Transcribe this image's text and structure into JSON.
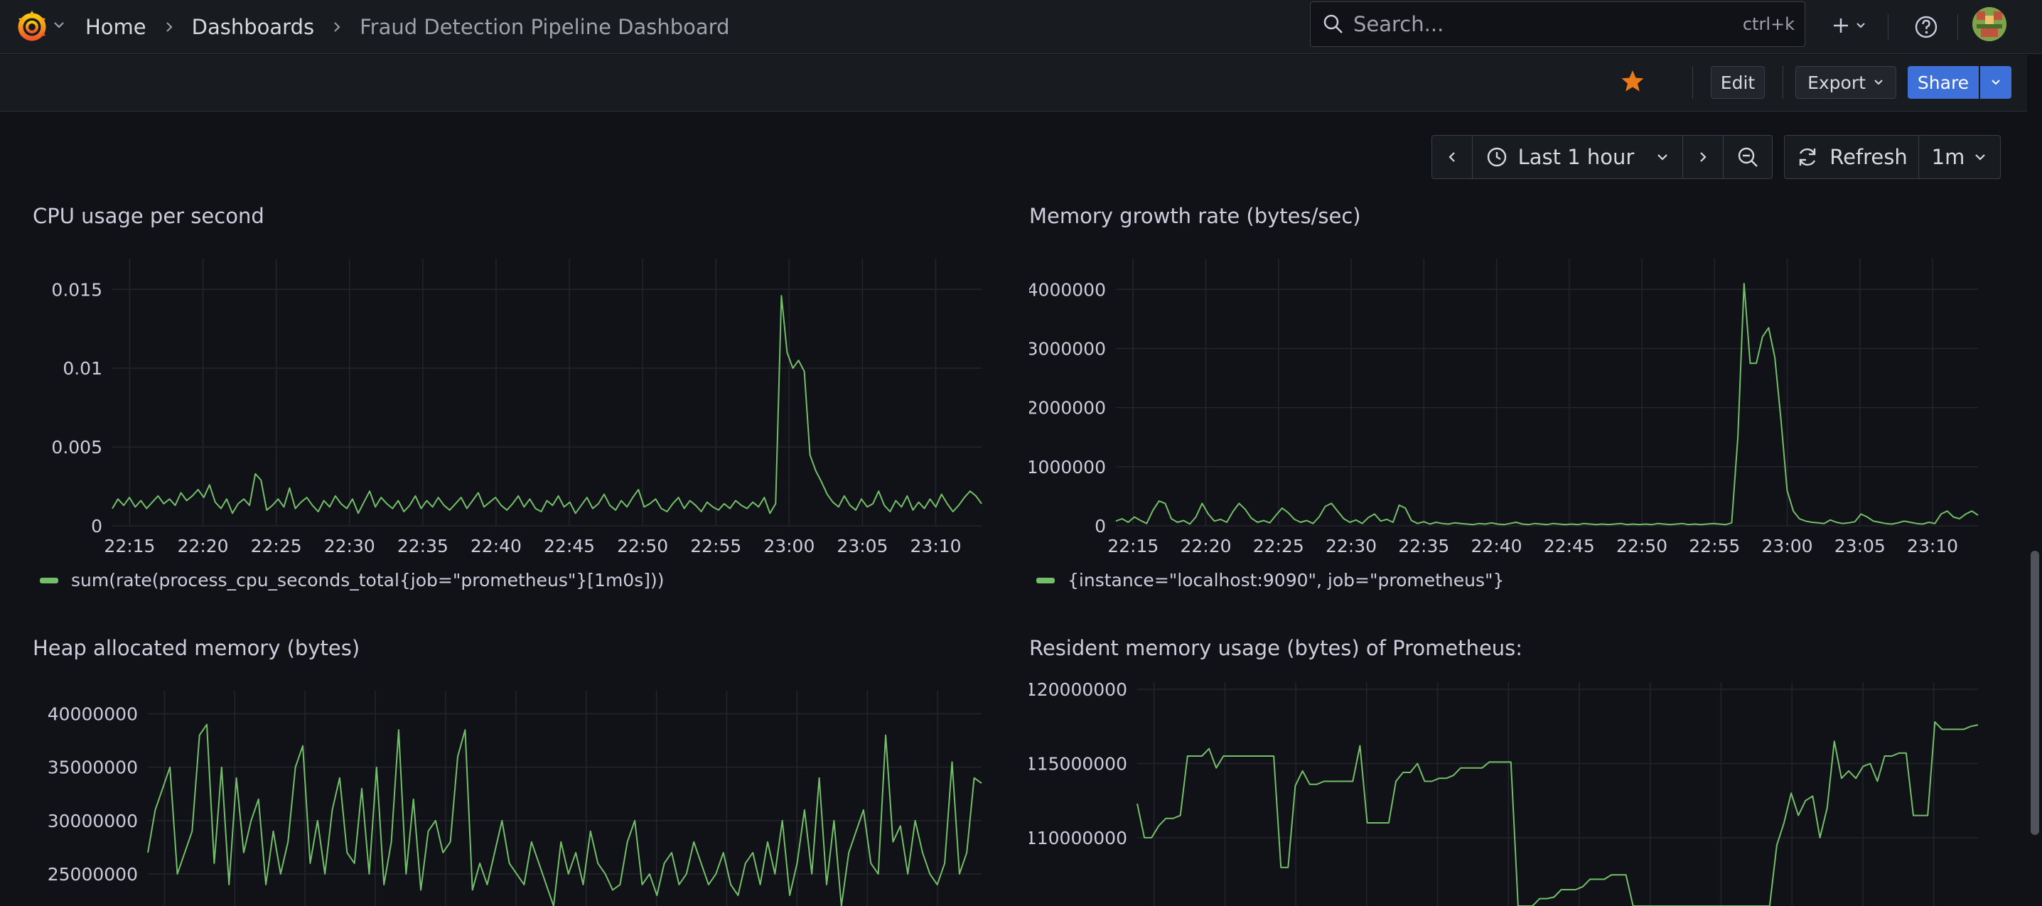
{
  "breadcrumbs": [
    "Home",
    "Dashboards",
    "Fraud Detection Pipeline Dashboard"
  ],
  "search": {
    "placeholder": "Search...",
    "shortcut": "ctrl+k"
  },
  "toolbar": {
    "edit_label": "Edit",
    "export_label": "Export",
    "share_label": "Share"
  },
  "time_controls": {
    "range_label": "Last 1 hour",
    "refresh_label": "Refresh",
    "interval_label": "1m"
  },
  "colors": {
    "series": "#73bf69",
    "accent": "#3d71d9",
    "star": "#eb7b18",
    "background": "#111217"
  },
  "icons": [
    "grafana-logo-icon",
    "chevron-right-icon",
    "search-icon",
    "plus-icon",
    "help-icon",
    "star-icon",
    "chevron-left-icon",
    "clock-icon",
    "zoom-out-icon",
    "refresh-icon",
    "chevron-down-icon"
  ],
  "panels": [
    {
      "title": "CPU usage per second",
      "legend": "sum(rate(process_cpu_seconds_total{job=\"prometheus\"}[1m0s]))"
    },
    {
      "title": "Memory growth rate (bytes/sec)",
      "legend": "{instance=\"localhost:9090\", job=\"prometheus\"}"
    },
    {
      "title": "Heap allocated memory (bytes)",
      "legend": ""
    },
    {
      "title": "Resident memory usage (bytes) of Prometheus:",
      "legend": ""
    }
  ],
  "chart_data": [
    {
      "type": "line",
      "title": "CPU usage per second",
      "x_ticks": [
        "22:15",
        "22:20",
        "22:25",
        "22:30",
        "22:35",
        "22:40",
        "22:45",
        "22:50",
        "22:55",
        "23:00",
        "23:05",
        "23:10"
      ],
      "y_ticks": [
        "0",
        "0.005",
        "0.01",
        "0.015"
      ],
      "ylim": [
        0,
        0.0165
      ],
      "grid": true,
      "series": [
        {
          "name": "sum(rate(process_cpu_seconds_total{job=\"prometheus\"}[1m0s]))",
          "values": [
            0.0011,
            0.0017,
            0.0013,
            0.0018,
            0.0012,
            0.0016,
            0.0011,
            0.0015,
            0.0019,
            0.0014,
            0.0017,
            0.0013,
            0.0021,
            0.0016,
            0.0019,
            0.0023,
            0.0018,
            0.0026,
            0.0015,
            0.0011,
            0.0017,
            0.0008,
            0.0014,
            0.0017,
            0.0013,
            0.0033,
            0.0029,
            0.001,
            0.0013,
            0.0017,
            0.0012,
            0.0024,
            0.0011,
            0.0015,
            0.0018,
            0.0013,
            0.0009,
            0.0016,
            0.0012,
            0.0019,
            0.0014,
            0.0011,
            0.0017,
            0.0008,
            0.0015,
            0.0022,
            0.0012,
            0.0018,
            0.0014,
            0.0011,
            0.0016,
            0.0009,
            0.0013,
            0.0019,
            0.0011,
            0.0016,
            0.0012,
            0.0018,
            0.0013,
            0.001,
            0.0014,
            0.0018,
            0.0011,
            0.0016,
            0.0021,
            0.0012,
            0.0015,
            0.0018,
            0.0013,
            0.001,
            0.0014,
            0.0019,
            0.0012,
            0.0017,
            0.0011,
            0.0009,
            0.0016,
            0.0013,
            0.0019,
            0.0012,
            0.0015,
            0.0008,
            0.0013,
            0.0018,
            0.0011,
            0.0014,
            0.002,
            0.0013,
            0.001,
            0.0016,
            0.0012,
            0.0018,
            0.0023,
            0.0012,
            0.0014,
            0.0017,
            0.0011,
            0.0009,
            0.0014,
            0.0018,
            0.0011,
            0.0016,
            0.0013,
            0.0009,
            0.0015,
            0.0012,
            0.001,
            0.0014,
            0.0011,
            0.0016,
            0.0013,
            0.0011,
            0.0015,
            0.0012,
            0.0018,
            0.0008,
            0.0014,
            0.0146,
            0.011,
            0.01,
            0.0105,
            0.0098,
            0.0045,
            0.0035,
            0.0028,
            0.002,
            0.0015,
            0.0012,
            0.0019,
            0.0013,
            0.001,
            0.0017,
            0.0012,
            0.0014,
            0.0022,
            0.0013,
            0.0009,
            0.0016,
            0.0012,
            0.0019,
            0.001,
            0.0015,
            0.0011,
            0.0017,
            0.0012,
            0.002,
            0.0014,
            0.0009,
            0.0013,
            0.0018,
            0.0022,
            0.0019,
            0.0014
          ]
        }
      ]
    },
    {
      "type": "line",
      "title": "Memory growth rate (bytes/sec)",
      "x_ticks": [
        "22:15",
        "22:20",
        "22:25",
        "22:30",
        "22:35",
        "22:40",
        "22:45",
        "22:50",
        "22:55",
        "23:00",
        "23:05",
        "23:10"
      ],
      "y_ticks": [
        "0",
        "1000000",
        "2000000",
        "3000000",
        "4000000"
      ],
      "ylim": [
        0,
        4400000
      ],
      "grid": true,
      "series": [
        {
          "name": "{instance=\"localhost:9090\", job=\"prometheus\"}",
          "values": [
            80000,
            120000,
            60000,
            150000,
            90000,
            40000,
            260000,
            420000,
            380000,
            120000,
            60000,
            90000,
            30000,
            150000,
            380000,
            200000,
            80000,
            110000,
            60000,
            240000,
            380000,
            280000,
            130000,
            60000,
            90000,
            50000,
            180000,
            300000,
            220000,
            110000,
            60000,
            90000,
            40000,
            150000,
            330000,
            380000,
            250000,
            120000,
            60000,
            100000,
            40000,
            140000,
            200000,
            80000,
            110000,
            60000,
            350000,
            300000,
            90000,
            40000,
            70000,
            30000,
            60000,
            40000,
            30000,
            50000,
            40000,
            30000,
            20000,
            40000,
            30000,
            50000,
            30000,
            20000,
            40000,
            60000,
            30000,
            20000,
            40000,
            30000,
            20000,
            40000,
            30000,
            20000,
            30000,
            20000,
            40000,
            30000,
            20000,
            30000,
            20000,
            30000,
            40000,
            20000,
            30000,
            20000,
            30000,
            20000,
            40000,
            30000,
            20000,
            30000,
            40000,
            20000,
            30000,
            20000,
            30000,
            40000,
            30000,
            20000,
            50000,
            1500000,
            4100000,
            2750000,
            2750000,
            3200000,
            3350000,
            2850000,
            1800000,
            600000,
            250000,
            120000,
            80000,
            60000,
            50000,
            40000,
            100000,
            60000,
            40000,
            50000,
            70000,
            200000,
            150000,
            80000,
            60000,
            40000,
            30000,
            50000,
            80000,
            60000,
            40000,
            30000,
            60000,
            40000,
            200000,
            250000,
            150000,
            120000,
            200000,
            250000,
            180000
          ]
        }
      ]
    },
    {
      "type": "line",
      "title": "Heap allocated memory (bytes)",
      "x_ticks": [],
      "y_ticks": [
        "25000000",
        "30000000",
        "35000000",
        "40000000"
      ],
      "ylim": [
        22000000,
        41500000
      ],
      "grid": true,
      "series": [
        {
          "name": "",
          "values": [
            27000000,
            31000000,
            33000000,
            35000000,
            25000000,
            27000000,
            29000000,
            38000000,
            39000000,
            26000000,
            35000000,
            24000000,
            34000000,
            27000000,
            30000000,
            32000000,
            24000000,
            29000000,
            25000000,
            28000000,
            35000000,
            37000000,
            26000000,
            30000000,
            25000000,
            31000000,
            34000000,
            27000000,
            26000000,
            33000000,
            25000000,
            35000000,
            24000000,
            28000000,
            38500000,
            25000000,
            32000000,
            23500000,
            29000000,
            30000000,
            27000000,
            28000000,
            36000000,
            38500000,
            23500000,
            26000000,
            24000000,
            27000000,
            30000000,
            26000000,
            25000000,
            24000000,
            28000000,
            26000000,
            24000000,
            22000000,
            28000000,
            25000000,
            27000000,
            24000000,
            29000000,
            26000000,
            25000000,
            23500000,
            24000000,
            28000000,
            30000000,
            24000000,
            25000000,
            23000000,
            26000000,
            27000000,
            24000000,
            25000000,
            28000000,
            26000000,
            24000000,
            25000000,
            27000000,
            24000000,
            23000000,
            26000000,
            27000000,
            24000000,
            28000000,
            25000000,
            30000000,
            23000000,
            26000000,
            31000000,
            25000000,
            34000000,
            24000000,
            30000000,
            22000000,
            27000000,
            29000000,
            31000000,
            26000000,
            25000000,
            38000000,
            28000000,
            29500000,
            25000000,
            30000000,
            27000000,
            25000000,
            24000000,
            26000000,
            35500000,
            25000000,
            27000000,
            34000000,
            33500000
          ]
        }
      ]
    },
    {
      "type": "line",
      "title": "Resident memory usage (bytes) of Prometheus:",
      "x_ticks": [],
      "y_ticks": [
        "110000000",
        "115000000",
        "120000000"
      ],
      "ylim": [
        105400000,
        120000000
      ],
      "grid": true,
      "series": [
        {
          "name": "",
          "values": [
            112300000,
            110000000,
            110000000,
            110800000,
            111300000,
            111300000,
            111500000,
            115500000,
            115500000,
            115500000,
            116000000,
            114700000,
            115500000,
            115500000,
            115500000,
            115500000,
            115500000,
            115500000,
            115500000,
            115500000,
            108000000,
            108000000,
            113500000,
            114500000,
            113600000,
            113600000,
            113800000,
            113800000,
            113800000,
            113800000,
            113800000,
            116200000,
            111000000,
            111000000,
            111000000,
            111000000,
            113800000,
            114400000,
            114400000,
            115000000,
            113800000,
            113800000,
            114000000,
            114000000,
            114200000,
            114700000,
            114700000,
            114700000,
            114700000,
            115100000,
            115100000,
            115100000,
            115100000,
            105400000,
            105400000,
            105400000,
            105900000,
            105900000,
            106000000,
            106500000,
            106500000,
            106500000,
            106700000,
            107200000,
            107200000,
            107200000,
            107500000,
            107500000,
            107500000,
            105400000,
            105400000,
            105400000,
            105400000,
            105400000,
            105400000,
            105400000,
            105400000,
            105400000,
            105400000,
            105400000,
            105400000,
            105400000,
            105400000,
            105400000,
            105400000,
            105400000,
            105400000,
            105400000,
            105400000,
            109500000,
            111000000,
            113000000,
            111500000,
            112500000,
            112800000,
            110000000,
            112000000,
            116500000,
            114000000,
            114500000,
            114000000,
            114800000,
            115000000,
            113800000,
            115500000,
            115500000,
            115700000,
            115700000,
            111500000,
            111500000,
            111500000,
            117800000,
            117300000,
            117300000,
            117300000,
            117300000,
            117500000,
            117600000
          ]
        }
      ]
    }
  ]
}
